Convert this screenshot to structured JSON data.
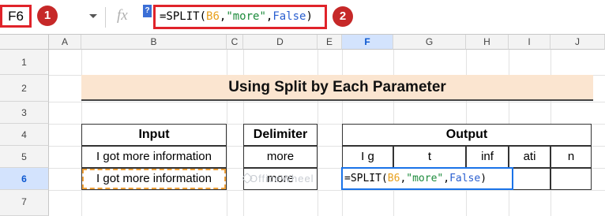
{
  "name_box": {
    "cell": "F6"
  },
  "badges": {
    "one": "1",
    "two": "2"
  },
  "formula_bar": {
    "fx_label": "fx",
    "marker": "?",
    "formula": {
      "prefix": "=SPLIT(",
      "ref": "B6",
      "sep1": ",",
      "str": "\"more\"",
      "sep2": ",",
      "kw": "False",
      "suffix": ")"
    }
  },
  "columns": [
    "A",
    "B",
    "C",
    "D",
    "E",
    "F",
    "G",
    "H",
    "I",
    "J"
  ],
  "rows": [
    "1",
    "2",
    "3",
    "4",
    "5",
    "6",
    "7"
  ],
  "title": "Using Split by Each Parameter",
  "input_table": {
    "header": "Input",
    "rows": [
      "I got more information",
      "I got more information"
    ]
  },
  "delimiter_table": {
    "header": "Delimiter",
    "rows": [
      "more",
      "more"
    ]
  },
  "output_table": {
    "header": "Output",
    "row5": [
      "I g",
      "t",
      "inf",
      "ati",
      "n"
    ],
    "editing_formula": {
      "prefix": "=SPLIT(",
      "ref": "B6",
      "sep1": ",",
      "str": "\"more\"",
      "sep2": ",",
      "kw": "False",
      "suffix": ")"
    }
  },
  "watermark": "OfficeWheel",
  "colors": {
    "highlight_red": "#e0232a",
    "badge_red": "#c62828",
    "title_fill": "#fbe5d0",
    "selection_blue": "#1a73e8",
    "ref_orange": "#e8a01d",
    "string_green": "#1d8b3c"
  }
}
